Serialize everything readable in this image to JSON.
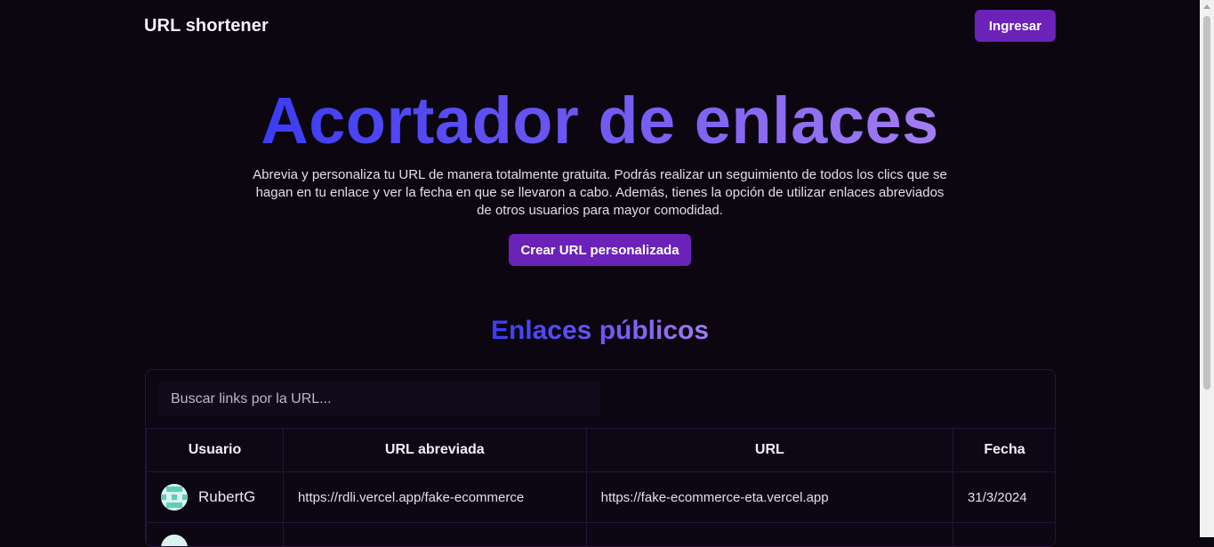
{
  "header": {
    "brand": "URL shortener",
    "login_label": "Ingresar"
  },
  "hero": {
    "title": "Acortador de enlaces",
    "description": "Abrevia y personaliza tu URL de manera totalmente gratuita. Podrás realizar un seguimiento de todos los clics que se hagan en tu enlace y ver la fecha en que se llevaron a cabo. Además, tienes la opción de utilizar enlaces abreviados de otros usuarios para mayor comodidad.",
    "cta_label": "Crear URL personalizada"
  },
  "public_links": {
    "title": "Enlaces públicos",
    "search_placeholder": "Buscar links por la URL...",
    "columns": [
      "Usuario",
      "URL abreviada",
      "URL",
      "Fecha"
    ],
    "rows": [
      {
        "user": "RubertG",
        "short_url": "https://rdli.vercel.app/fake-ecommerce",
        "url": "https://fake-ecommerce-eta.vercel.app",
        "date": "31/3/2024"
      }
    ]
  },
  "colors": {
    "background": "#0b0610",
    "accent": "#6a22b8",
    "gradient_start": "#3a3cf5",
    "gradient_end": "#a37df0"
  }
}
